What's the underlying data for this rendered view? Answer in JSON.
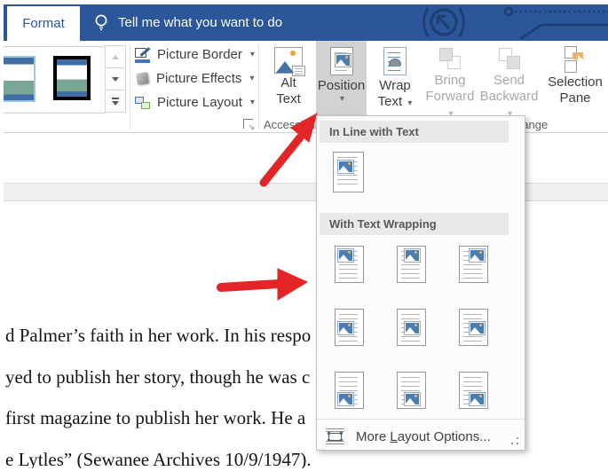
{
  "titlebar": {
    "tab": "Format",
    "tell_me": "Tell me what you want to do"
  },
  "ribbon": {
    "picture_border": "Picture Border",
    "picture_effects": "Picture Effects",
    "picture_layout": "Picture Layout",
    "alt_text": {
      "line1": "Alt",
      "line2": "Text"
    },
    "position": "Position",
    "wrap_text": {
      "line1": "Wrap",
      "line2": "Text"
    },
    "bring_forward": {
      "line1": "Bring",
      "line2": "Forward"
    },
    "send_backward": {
      "line1": "Send",
      "line2": "Backward"
    },
    "selection_pane": {
      "line1": "Selection",
      "line2": "Pane"
    },
    "caret": "▾",
    "groups": {
      "accessibility": "Accessibility",
      "arrange": "Arrange"
    }
  },
  "dropdown": {
    "sections": [
      {
        "title": "In Line with Text"
      },
      {
        "title": "With Text Wrapping"
      }
    ],
    "inline_option": "in-line-with-text",
    "grid_positions": [
      "top-left",
      "top-center",
      "top-right",
      "middle-left",
      "middle-center",
      "middle-right",
      "bottom-left",
      "bottom-center",
      "bottom-right"
    ],
    "more_layout": {
      "pre": "More ",
      "accel": "L",
      "post": "ayout Options..."
    }
  },
  "document": {
    "lines": [
      "d Palmer’s faith in her work. In his respo",
      "yed to publish her story, though he was c",
      "first magazine to publish her work. He a",
      "e Lytles” (Sewanee Archives 10/9/1947)."
    ]
  },
  "colors": {
    "word_blue": "#2b579a",
    "arrow_red": "#e42527",
    "selected_button_gray": "#d2d2d2",
    "header_gray": "#e9e9e9",
    "disabled_text": "#a8a8a8"
  },
  "icons": {
    "lightbulb-icon": "outlined bulb",
    "picture-border-icon": "pen with blue color bar",
    "picture-effects-icon": "gray 3d square",
    "picture-layout-icon": "layout diagram",
    "alt-text-icon": "picture with caption card",
    "position-icon": "page with picture thumbnail",
    "wrap-text-icon": "page with arc over text lines",
    "bring-forward-icon": "overlapping squares",
    "send-backward-icon": "overlapping squares",
    "selection-pane-icon": "squares with cursor",
    "more-layout-icon": "object between text lines with handles",
    "dialog-launcher-icon": "corner arrow",
    "resize-grip-icon": "dotted triangle"
  }
}
